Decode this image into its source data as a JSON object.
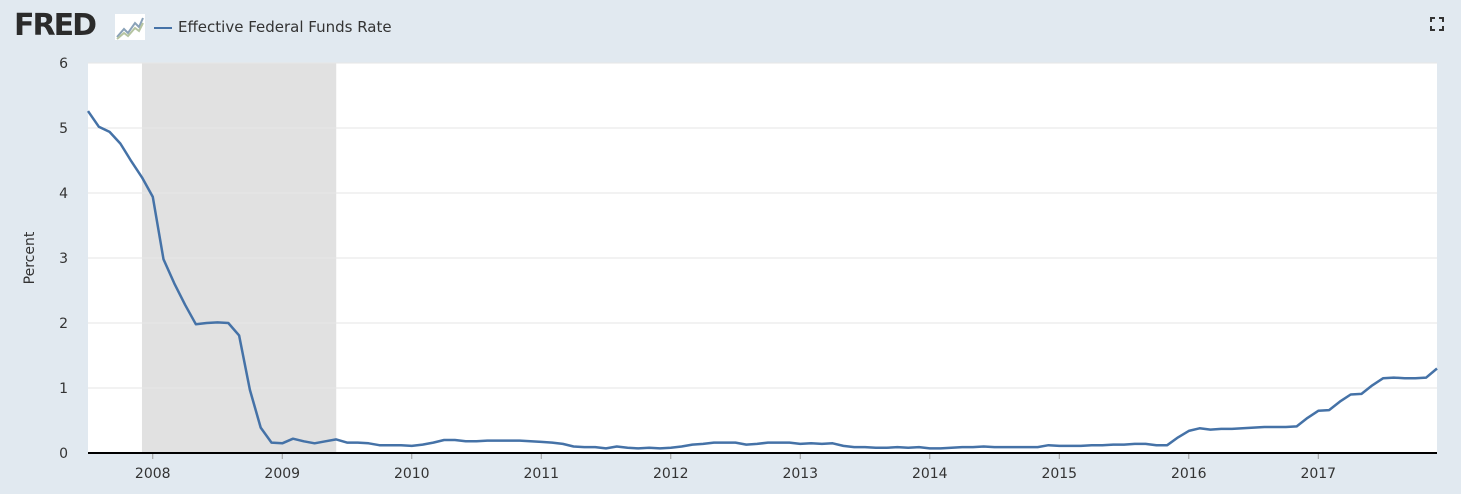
{
  "header": {
    "logo_text": "FRED",
    "logo_icon": "chart-line-icon",
    "legend_label": "Effective Federal Funds Rate",
    "expand_icon": "expand-icon"
  },
  "colors": {
    "series": "#4572a7",
    "recession": "#e1e1e1",
    "background": "#e1e9f0",
    "plot": "#ffffff",
    "grid": "#e6e6e6"
  },
  "chart_data": {
    "type": "line",
    "title": "",
    "xlabel": "",
    "ylabel": "Percent",
    "ylim": [
      0,
      6
    ],
    "xlim": [
      "2007-07-01",
      "2017-12-01"
    ],
    "yticks": [
      "0",
      "1",
      "2",
      "3",
      "4",
      "5",
      "6"
    ],
    "xticks": [
      "2008",
      "2009",
      "2010",
      "2011",
      "2012",
      "2013",
      "2014",
      "2015",
      "2016",
      "2017"
    ],
    "grid": true,
    "recession": {
      "start": "2007-12-01",
      "end": "2009-06-01"
    },
    "series": [
      {
        "name": "Effective Federal Funds Rate",
        "x": [
          "2007-07",
          "2007-08",
          "2007-09",
          "2007-10",
          "2007-11",
          "2007-12",
          "2008-01",
          "2008-02",
          "2008-03",
          "2008-04",
          "2008-05",
          "2008-06",
          "2008-07",
          "2008-08",
          "2008-09",
          "2008-10",
          "2008-11",
          "2008-12",
          "2009-01",
          "2009-02",
          "2009-03",
          "2009-04",
          "2009-05",
          "2009-06",
          "2009-07",
          "2009-08",
          "2009-09",
          "2009-10",
          "2009-11",
          "2009-12",
          "2010-01",
          "2010-02",
          "2010-03",
          "2010-04",
          "2010-05",
          "2010-06",
          "2010-07",
          "2010-08",
          "2010-09",
          "2010-10",
          "2010-11",
          "2010-12",
          "2011-01",
          "2011-02",
          "2011-03",
          "2011-04",
          "2011-05",
          "2011-06",
          "2011-07",
          "2011-08",
          "2011-09",
          "2011-10",
          "2011-11",
          "2011-12",
          "2012-01",
          "2012-02",
          "2012-03",
          "2012-04",
          "2012-05",
          "2012-06",
          "2012-07",
          "2012-08",
          "2012-09",
          "2012-10",
          "2012-11",
          "2012-12",
          "2013-01",
          "2013-02",
          "2013-03",
          "2013-04",
          "2013-05",
          "2013-06",
          "2013-07",
          "2013-08",
          "2013-09",
          "2013-10",
          "2013-11",
          "2013-12",
          "2014-01",
          "2014-02",
          "2014-03",
          "2014-04",
          "2014-05",
          "2014-06",
          "2014-07",
          "2014-08",
          "2014-09",
          "2014-10",
          "2014-11",
          "2014-12",
          "2015-01",
          "2015-02",
          "2015-03",
          "2015-04",
          "2015-05",
          "2015-06",
          "2015-07",
          "2015-08",
          "2015-09",
          "2015-10",
          "2015-11",
          "2015-12",
          "2016-01",
          "2016-02",
          "2016-03",
          "2016-04",
          "2016-05",
          "2016-06",
          "2016-07",
          "2016-08",
          "2016-09",
          "2016-10",
          "2016-11",
          "2016-12",
          "2017-01",
          "2017-02",
          "2017-03",
          "2017-04",
          "2017-05",
          "2017-06",
          "2017-07",
          "2017-08",
          "2017-09",
          "2017-10",
          "2017-11",
          "2017-12"
        ],
        "values": [
          5.26,
          5.02,
          4.94,
          4.76,
          4.49,
          4.24,
          3.94,
          2.98,
          2.61,
          2.28,
          1.98,
          2.0,
          2.01,
          2.0,
          1.81,
          0.97,
          0.39,
          0.16,
          0.15,
          0.22,
          0.18,
          0.15,
          0.18,
          0.21,
          0.16,
          0.16,
          0.15,
          0.12,
          0.12,
          0.12,
          0.11,
          0.13,
          0.16,
          0.2,
          0.2,
          0.18,
          0.18,
          0.19,
          0.19,
          0.19,
          0.19,
          0.18,
          0.17,
          0.16,
          0.14,
          0.1,
          0.09,
          0.09,
          0.07,
          0.1,
          0.08,
          0.07,
          0.08,
          0.07,
          0.08,
          0.1,
          0.13,
          0.14,
          0.16,
          0.16,
          0.16,
          0.13,
          0.14,
          0.16,
          0.16,
          0.16,
          0.14,
          0.15,
          0.14,
          0.15,
          0.11,
          0.09,
          0.09,
          0.08,
          0.08,
          0.09,
          0.08,
          0.09,
          0.07,
          0.07,
          0.08,
          0.09,
          0.09,
          0.1,
          0.09,
          0.09,
          0.09,
          0.09,
          0.09,
          0.12,
          0.11,
          0.11,
          0.11,
          0.12,
          0.12,
          0.13,
          0.13,
          0.14,
          0.14,
          0.12,
          0.12,
          0.24,
          0.34,
          0.38,
          0.36,
          0.37,
          0.37,
          0.38,
          0.39,
          0.4,
          0.4,
          0.4,
          0.41,
          0.54,
          0.65,
          0.66,
          0.79,
          0.9,
          0.91,
          1.04,
          1.15,
          1.16,
          1.15,
          1.15,
          1.16,
          1.3
        ]
      }
    ]
  }
}
